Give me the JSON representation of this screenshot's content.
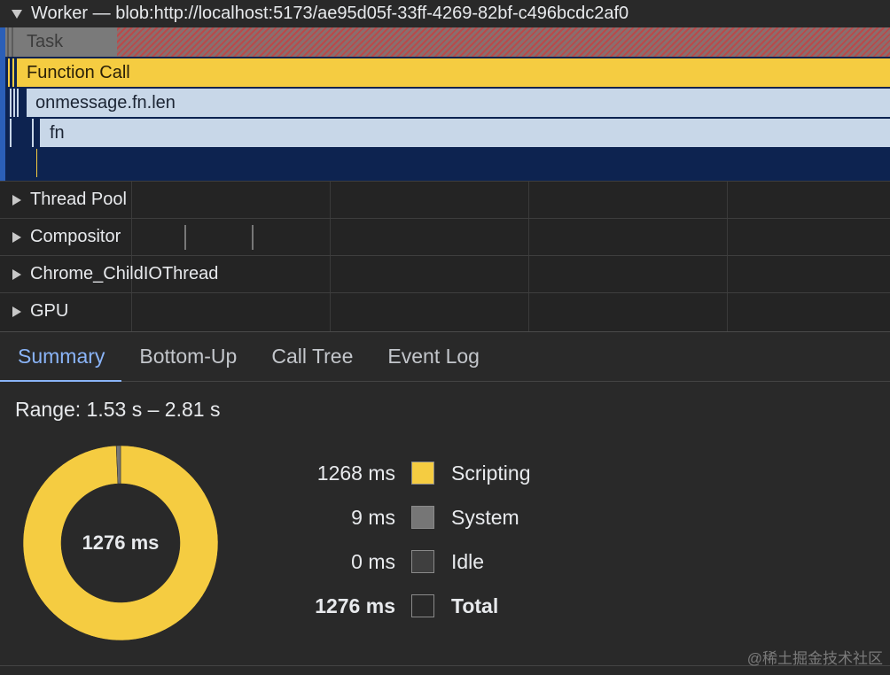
{
  "timeline": {
    "worker_title": "Worker — blob:http://localhost:5173/ae95d05f-33ff-4269-82bf-c496bcdc2af0",
    "events": {
      "task": "Task",
      "function_call": "Function Call",
      "onmessage": "onmessage.fn.len",
      "fn": "fn"
    },
    "threads": [
      {
        "label": "Thread Pool"
      },
      {
        "label": "Compositor"
      },
      {
        "label": "Chrome_ChildIOThread"
      },
      {
        "label": "GPU"
      }
    ]
  },
  "details": {
    "tabs": [
      {
        "label": "Summary",
        "active": true
      },
      {
        "label": "Bottom-Up",
        "active": false
      },
      {
        "label": "Call Tree",
        "active": false
      },
      {
        "label": "Event Log",
        "active": false
      }
    ],
    "range": "Range: 1.53 s – 2.81 s",
    "total_center": "1276 ms",
    "breakdown": [
      {
        "value": "1268 ms",
        "label": "Scripting",
        "color": "#f5cc41"
      },
      {
        "value": "9 ms",
        "label": "System",
        "color": "#767676"
      },
      {
        "value": "0 ms",
        "label": "Idle",
        "color": "#3f3f3f"
      },
      {
        "value": "1276 ms",
        "label": "Total",
        "color": "#292929"
      }
    ],
    "chart_data": {
      "type": "pie",
      "categories": [
        "Scripting",
        "System",
        "Idle"
      ],
      "values": [
        1268,
        9,
        0
      ],
      "colors": [
        "#f5cc41",
        "#767676",
        "#3f3f3f"
      ]
    }
  },
  "watermark": "@稀土掘金技术社区"
}
